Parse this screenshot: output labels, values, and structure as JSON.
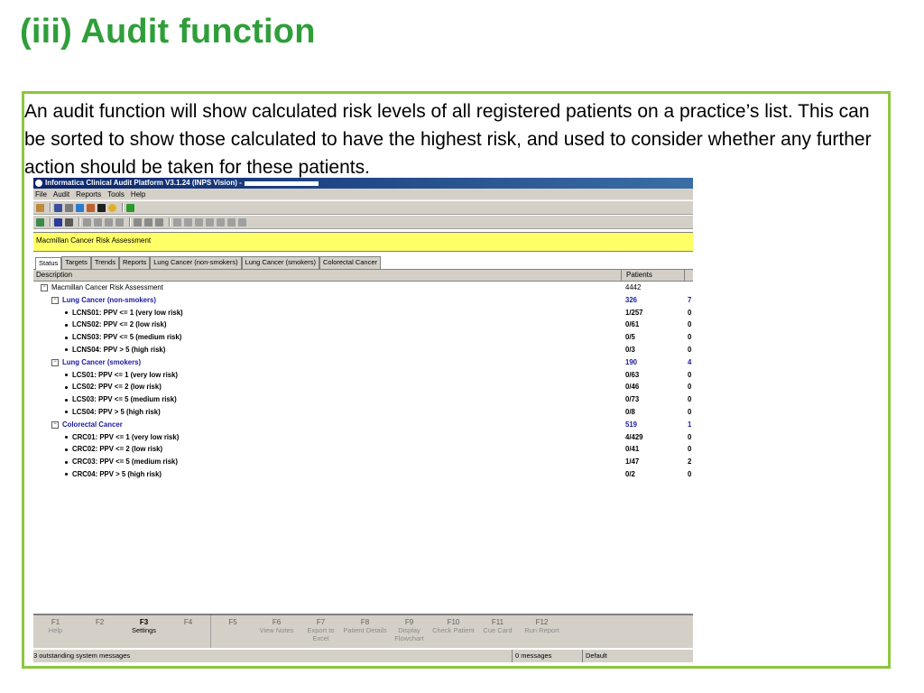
{
  "slide": {
    "title": "(iii) Audit function",
    "description": "An audit function will show calculated risk levels of all registered patients on a practice’s list. This can be sorted to show those calculated to have the highest risk, and used to consider whether any further action should be taken for these patients."
  },
  "app": {
    "window_title": "Informatica Clinical Audit Platform V3.1.24 (INPS Vision) -",
    "menu": [
      "File",
      "Audit",
      "Reports",
      "Tools",
      "Help"
    ],
    "report_name": "Macmillan Cancer Risk Assessment",
    "tabs": [
      "Status",
      "Targets",
      "Trends",
      "Reports",
      "Lung Cancer (non-smokers)",
      "Lung Cancer (smokers)",
      "Colorectal Cancer"
    ],
    "active_tab": "Status",
    "columns": {
      "description": "Description",
      "patients": "Patients"
    },
    "rows": [
      {
        "label": "Macmillan Cancer Risk Assessment",
        "patients": "4442",
        "extra": "",
        "level": 0,
        "style": "normal"
      },
      {
        "label": "Lung Cancer (non-smokers)",
        "patients": "326",
        "extra": "7",
        "level": 1,
        "style": "group"
      },
      {
        "label": "LCNS01: PPV <= 1 (very low risk)",
        "patients": "1/257",
        "extra": "0",
        "level": 2,
        "style": "item"
      },
      {
        "label": "LCNS02: PPV <= 2 (low risk)",
        "patients": "0/61",
        "extra": "0",
        "level": 2,
        "style": "item"
      },
      {
        "label": "LCNS03: PPV <= 5 (medium risk)",
        "patients": "0/5",
        "extra": "0",
        "level": 2,
        "style": "item"
      },
      {
        "label": "LCNS04: PPV > 5 (high risk)",
        "patients": "0/3",
        "extra": "0",
        "level": 2,
        "style": "item"
      },
      {
        "label": "Lung Cancer (smokers)",
        "patients": "190",
        "extra": "4",
        "level": 1,
        "style": "group"
      },
      {
        "label": "LCS01: PPV <= 1 (very low risk)",
        "patients": "0/63",
        "extra": "0",
        "level": 2,
        "style": "item"
      },
      {
        "label": "LCS02: PPV <= 2 (low risk)",
        "patients": "0/46",
        "extra": "0",
        "level": 2,
        "style": "item"
      },
      {
        "label": "LCS03: PPV <= 5 (medium risk)",
        "patients": "0/73",
        "extra": "0",
        "level": 2,
        "style": "item"
      },
      {
        "label": "LCS04: PPV > 5 (high risk)",
        "patients": "0/8",
        "extra": "0",
        "level": 2,
        "style": "item"
      },
      {
        "label": "Colorectal Cancer",
        "patients": "519",
        "extra": "1",
        "level": 1,
        "style": "group"
      },
      {
        "label": "CRC01: PPV <= 1 (very low risk)",
        "patients": "4/429",
        "extra": "0",
        "level": 2,
        "style": "item"
      },
      {
        "label": "CRC02: PPV <= 2 (low risk)",
        "patients": "0/41",
        "extra": "0",
        "level": 2,
        "style": "item"
      },
      {
        "label": "CRC03: PPV <= 5 (medium risk)",
        "patients": "1/47",
        "extra": "2",
        "level": 2,
        "style": "item"
      },
      {
        "label": "CRC04: PPV > 5 (high risk)",
        "patients": "0/2",
        "extra": "0",
        "level": 2,
        "style": "item"
      }
    ],
    "function_keys": [
      {
        "key": "F1",
        "label": "Help"
      },
      {
        "key": "F2",
        "label": ""
      },
      {
        "key": "F3",
        "label": "Settings"
      },
      {
        "key": "F4",
        "label": ""
      },
      {
        "key": "F5",
        "label": ""
      },
      {
        "key": "F6",
        "label": "View Notes"
      },
      {
        "key": "F7",
        "label": "Export to Excel"
      },
      {
        "key": "F8",
        "label": "Patient Details"
      },
      {
        "key": "F9",
        "label": "Display Flowchart"
      },
      {
        "key": "F10",
        "label": "Check Patient"
      },
      {
        "key": "F11",
        "label": "Cue Card"
      },
      {
        "key": "F12",
        "label": "Run Report"
      }
    ],
    "status": {
      "system_messages": "3 outstanding system messages",
      "messages": "0 messages",
      "profile": "Default"
    }
  },
  "colors": {
    "title_green": "#2f9e3a",
    "frame_green": "#8cc63f",
    "highlight_yellow": "#ffff66",
    "group_blue": "#1a1aa0"
  }
}
